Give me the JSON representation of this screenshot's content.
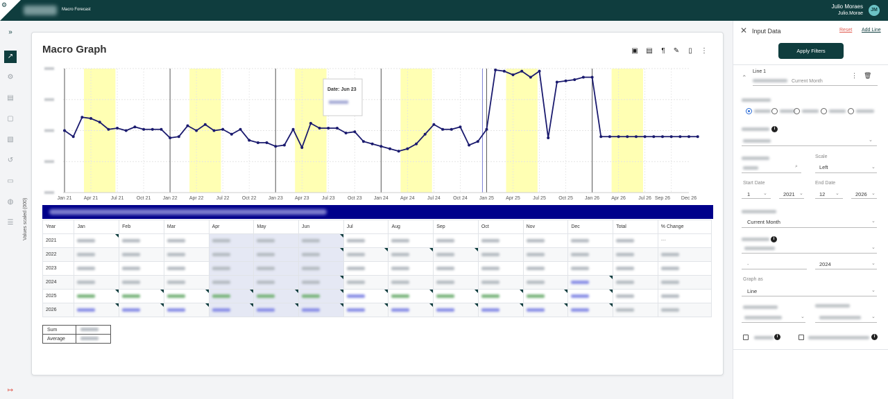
{
  "header": {
    "app_name": "Macro Forecast",
    "user_name": "Julio Moraes",
    "user_email": "Julio.Morae",
    "avatar_initials": "JM"
  },
  "card": {
    "title": "Macro Graph",
    "y_axis_label": "Values scaled (000)",
    "tooltip_title": "Date: Jun 23"
  },
  "chart_data": {
    "type": "line",
    "x_tick_labels": [
      "Jan 21",
      "Apr 21",
      "Jul 21",
      "Oct 21",
      "Jan 22",
      "Apr 22",
      "Jul 22",
      "Oct 22",
      "Jan 23",
      "Apr 23",
      "Jul 23",
      "Oct 23",
      "Jan 24",
      "Apr 24",
      "Jul 24",
      "Oct 24",
      "Jan 25",
      "Apr 25",
      "Jul 25",
      "Oct 25",
      "Jan 26",
      "Apr 26",
      "Jul 26",
      "Sep 26",
      "Dec 26"
    ],
    "series": [
      {
        "color": "#1a1a6e",
        "values": [
          50,
          45,
          61,
          60,
          57,
          51,
          52,
          50,
          53,
          51,
          51,
          51,
          44,
          45,
          54,
          50,
          55,
          50,
          51,
          47,
          51,
          42,
          40,
          40,
          37,
          38,
          51,
          36,
          56,
          52,
          52,
          52,
          48,
          49,
          41,
          39,
          37,
          35,
          33,
          35,
          39,
          47,
          55,
          51,
          51,
          53,
          38,
          41,
          51,
          100,
          99,
          96,
          99,
          94,
          99,
          44,
          90,
          91,
          92,
          94,
          94,
          45,
          45,
          45,
          45,
          45,
          45,
          45,
          45,
          45,
          45,
          45,
          45
        ]
      }
    ],
    "highlight_color": "#ffffb3"
  },
  "table": {
    "headers": [
      "Year",
      "Jan",
      "Feb",
      "Mar",
      "Apr",
      "May",
      "Jun",
      "Jul",
      "Aug",
      "Sep",
      "Oct",
      "Nov",
      "Dec",
      "Total",
      "% Change"
    ],
    "years": [
      "2021",
      "2022",
      "2023",
      "2024",
      "2025",
      "2026"
    ],
    "change_2021": "---"
  },
  "summary": {
    "sum_label": "Sum",
    "average_label": "Average"
  },
  "panel": {
    "title": "Input Data",
    "reset": "Reset",
    "add_line": "Add Line",
    "apply": "Apply Filters",
    "line_label": "Line 1",
    "line_sub": "Current Month",
    "scale_label": "Scale",
    "scale_value": "Left",
    "start_date_label": "Start Date",
    "start_month": "1",
    "start_year": "2021",
    "end_date_label": "End Date",
    "end_month": "12",
    "end_year": "2026",
    "current_month": "Current Month",
    "dash": "-",
    "year_2024": "2024",
    "graph_as_label": "Graph as",
    "graph_as_value": "Line"
  }
}
